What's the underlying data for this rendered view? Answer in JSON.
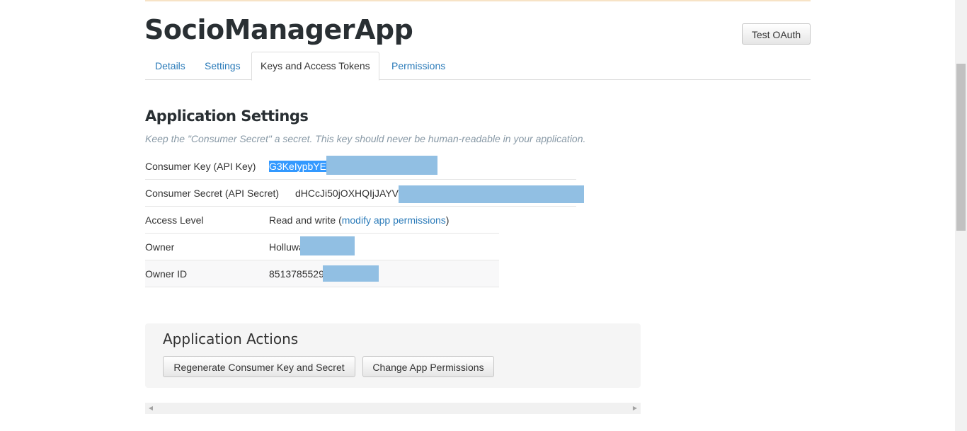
{
  "app": {
    "title": "SocioManagerApp",
    "test_oauth_label": "Test OAuth"
  },
  "tabs": [
    "Details",
    "Settings",
    "Keys and Access Tokens",
    "Permissions"
  ],
  "active_tab": "Keys and Access Tokens",
  "settings": {
    "heading": "Application Settings",
    "note": "Keep the \"Consumer Secret\" a secret. This key should never be human-readable in your application.",
    "consumer_key": {
      "label": "Consumer Key (API Key)",
      "value": "G3KeIypbYE"
    },
    "consumer_secret": {
      "label": "Consumer Secret (API Secret)",
      "value": "dHCcJi50jOXHQIjJAYV"
    },
    "access_level": {
      "label": "Access Level",
      "value": "Read and write",
      "open_paren": "(",
      "link": "modify app permissions",
      "close_paren": ")"
    },
    "owner": {
      "label": "Owner",
      "value": "Holluwa"
    },
    "owner_id": {
      "label": "Owner ID",
      "value": "85137855290"
    }
  },
  "actions": {
    "heading": "Application Actions",
    "regenerate_label": "Regenerate Consumer Key and Secret",
    "change_permissions_label": "Change App Permissions"
  },
  "icons": {
    "scroll_left": "◀",
    "scroll_right": "▶"
  },
  "colors": {
    "link": "#2b7bb9",
    "selection": "#3399ff",
    "redaction": "#91bfe3"
  }
}
